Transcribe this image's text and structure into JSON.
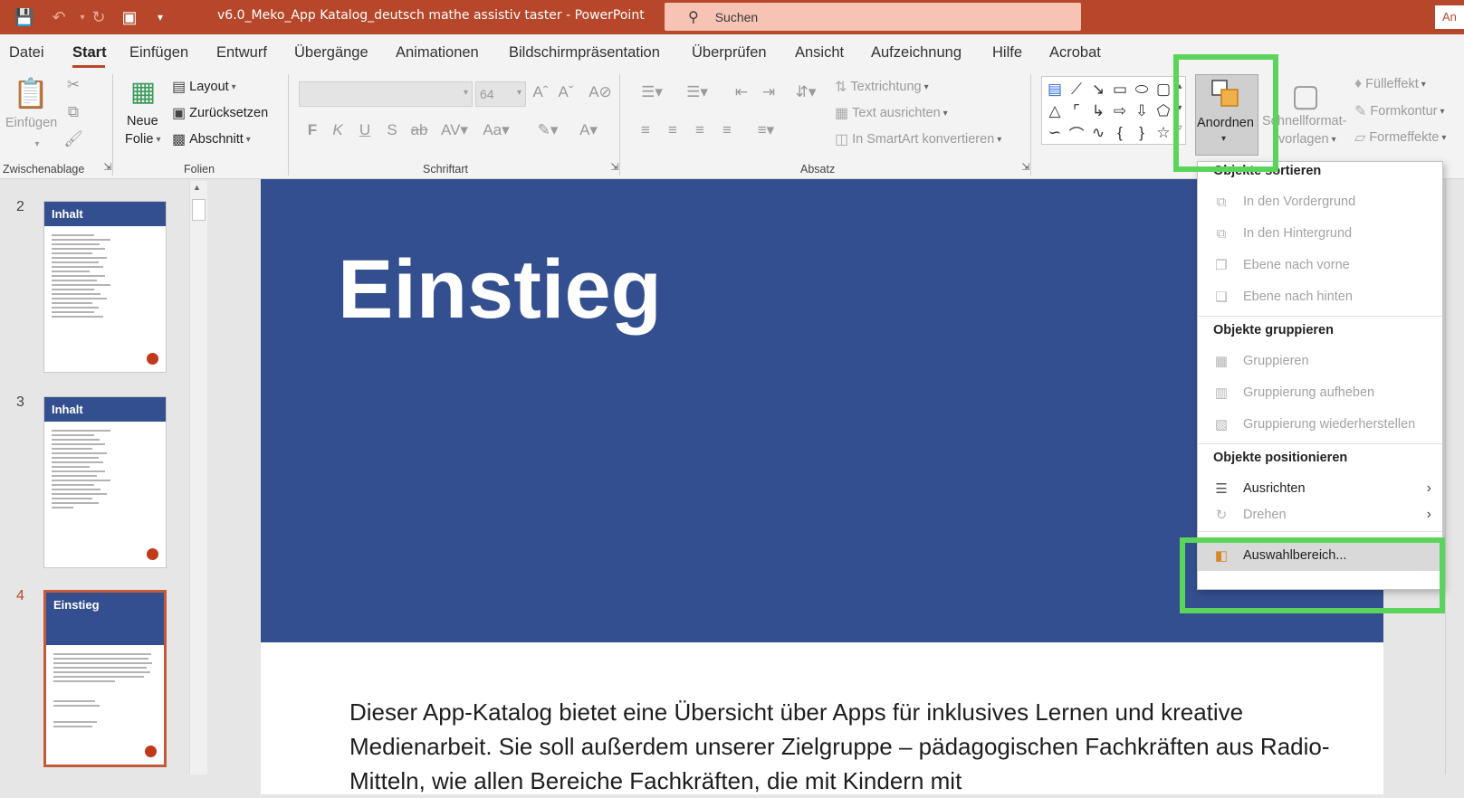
{
  "title_bar": {
    "document_title": "v6.0_Meko_App Katalog_deutsch mathe assistiv taster  -  PowerPoint",
    "search_placeholder": "Suchen",
    "user_button": "An"
  },
  "tabs": [
    "Datei",
    "Start",
    "Einfügen",
    "Entwurf",
    "Übergänge",
    "Animationen",
    "Bildschirmpräsentation",
    "Überprüfen",
    "Ansicht",
    "Aufzeichnung",
    "Hilfe",
    "Acrobat"
  ],
  "active_tab": "Start",
  "ribbon": {
    "clipboard": {
      "paste": "Einfügen",
      "group_label": "Zwischenablage"
    },
    "slides": {
      "new_slide_line1": "Neue",
      "new_slide_line2": "Folie",
      "layout": "Layout",
      "reset": "Zurücksetzen",
      "section": "Abschnitt",
      "group_label": "Folien"
    },
    "font": {
      "font_size": "64",
      "group_label": "Schriftart"
    },
    "paragraph": {
      "text_direction": "Textrichtung",
      "align_text": "Text ausrichten",
      "smartart": "In SmartArt konvertieren",
      "group_label": "Absatz"
    },
    "drawing": {
      "arrange": "Anordnen",
      "quick_styles_line1": "Schnellformat-",
      "quick_styles_line2": "vorlagen",
      "fill": "Fülleffekt",
      "outline": "Formkontur",
      "effects": "Formeffekte"
    }
  },
  "slides": [
    {
      "number": "2",
      "title": "Inhalt"
    },
    {
      "number": "3",
      "title": "Inhalt"
    },
    {
      "number": "4",
      "title": "Einstieg"
    }
  ],
  "current_slide": {
    "title": "Einstieg",
    "body": "Dieser App-Katalog bietet eine Übersicht über Apps für inklusives Lernen und kreative Medienarbeit. Sie soll außerdem unserer Zielgruppe – pädagogischen Fachkräften aus Radio-Mitteln, wie allen Bereiche Fachkräften, die mit Kindern mit"
  },
  "arrange_menu": {
    "section_order": "Objekte sortieren",
    "bring_front": "In den Vordergrund",
    "send_back": "In den Hintergrund",
    "bring_forward": "Ebene nach vorne",
    "send_backward": "Ebene nach hinten",
    "section_group": "Objekte gruppieren",
    "group": "Gruppieren",
    "ungroup": "Gruppierung aufheben",
    "regroup": "Gruppierung wiederherstellen",
    "section_position": "Objekte positionieren",
    "align": "Ausrichten",
    "rotate": "Drehen",
    "selection_pane": "Auswahlbereich..."
  },
  "colors": {
    "accent": "#b7472a",
    "slide_header": "#334f8f",
    "highlight": "#5ad45a"
  }
}
